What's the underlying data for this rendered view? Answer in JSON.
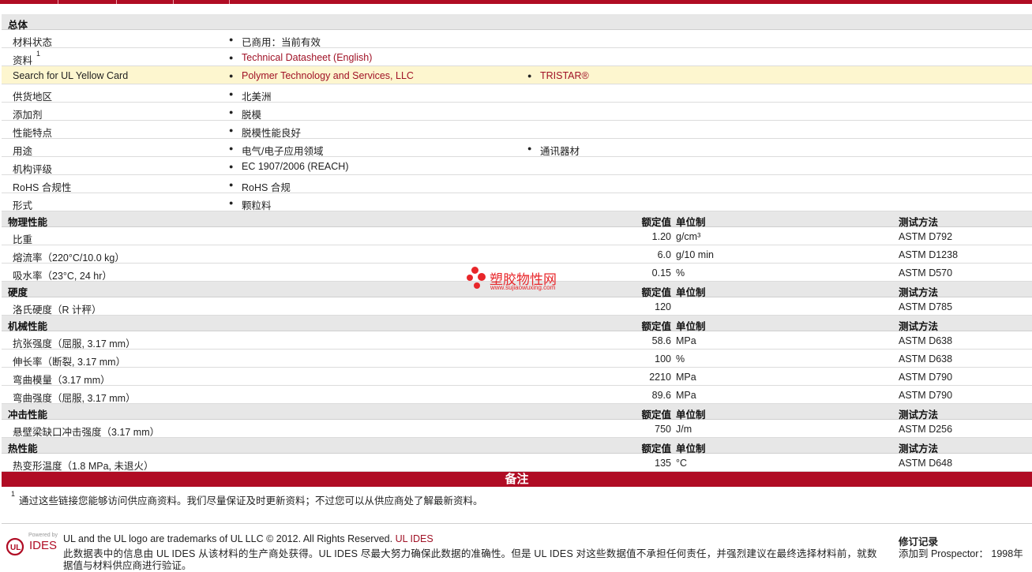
{
  "general": {
    "header": "总体",
    "rows": [
      {
        "label": "材料状态",
        "values": [
          "已商用：当前有效"
        ],
        "links": false
      },
      {
        "label": "资料",
        "sup": "1",
        "values": [
          "Technical Datasheet (English)"
        ],
        "links": true
      },
      {
        "label": "Search for UL Yellow Card",
        "values": [
          "Polymer Technology and Services, LLC",
          "TRISTAR®"
        ],
        "links": true,
        "highlight": true
      },
      {
        "label": "供货地区",
        "values": [
          "北美洲"
        ],
        "links": false
      },
      {
        "label": "添加剂",
        "values": [
          "脱模"
        ],
        "links": false
      },
      {
        "label": "性能特点",
        "values": [
          "脱模性能良好"
        ],
        "links": false
      },
      {
        "label": "用途",
        "values": [
          "电气/电子应用领域",
          "通讯器材"
        ],
        "links": false
      },
      {
        "label": "机构评级",
        "values": [
          "EC 1907/2006 (REACH)"
        ],
        "links": false
      },
      {
        "label": "RoHS 合规性",
        "values": [
          "RoHS 合规"
        ],
        "links": false
      },
      {
        "label": "形式",
        "values": [
          "颗粒料"
        ],
        "links": false
      }
    ]
  },
  "columns": {
    "rated_value": "额定值",
    "unit_system": "单位制",
    "test_method": "测试方法"
  },
  "bullet": "●",
  "sections": [
    {
      "title": "物理性能",
      "rows": [
        {
          "label": "比重",
          "value": "1.20",
          "unit": "g/cm³",
          "test": "ASTM D792"
        },
        {
          "label": "熔流率（220°C/10.0 kg）",
          "value": "6.0",
          "unit": "g/10 min",
          "test": "ASTM D1238"
        },
        {
          "label": "吸水率（23°C, 24 hr）",
          "value": "0.15",
          "unit": "%",
          "test": "ASTM D570"
        }
      ]
    },
    {
      "title": "硬度",
      "rows": [
        {
          "label": "洛氏硬度（R 计秤）",
          "value": "120",
          "unit": "",
          "test": "ASTM D785"
        }
      ]
    },
    {
      "title": "机械性能",
      "rows": [
        {
          "label": "抗张强度（屈服, 3.17 mm）",
          "value": "58.6",
          "unit": "MPa",
          "test": "ASTM D638"
        },
        {
          "label": "伸长率（断裂, 3.17 mm）",
          "value": "100",
          "unit": "%",
          "test": "ASTM D638"
        },
        {
          "label": "弯曲模量（3.17 mm）",
          "value": "2210",
          "unit": "MPa",
          "test": "ASTM D790"
        },
        {
          "label": "弯曲强度（屈服, 3.17 mm）",
          "value": "89.6",
          "unit": "MPa",
          "test": "ASTM D790"
        }
      ]
    },
    {
      "title": "冲击性能",
      "rows": [
        {
          "label": "悬壁梁缺口冲击强度（3.17 mm）",
          "value": "750",
          "unit": "J/m",
          "test": "ASTM D256"
        }
      ]
    },
    {
      "title": "热性能",
      "rows": [
        {
          "label": "热变形温度（1.8 MPa, 未退火）",
          "value": "135",
          "unit": "°C",
          "test": "ASTM D648"
        }
      ]
    }
  ],
  "notes": {
    "title": "备注",
    "sup": "1",
    "text": "通过这些链接您能够访问供应商资料。我们尽量保证及时更新资料；不过您可以从供应商处了解最新资料。"
  },
  "footer": {
    "trademark": "UL and the UL logo are trademarks of UL LLC © 2012. All Rights Reserved.",
    "trademark_link": "UL IDES",
    "disclaimer": "此数据表中的信息由  UL IDES 从该材料的生产商处获得。UL IDES 尽最大努力确保此数据的准确性。但是  UL IDES 对这些数据值不承担任何责任，并强烈建议在最终选择材料前，就数",
    "disclaimer_cont": "据值与材料供应商进行验证。",
    "logo_powered": "Powered by",
    "logo_text": "IDES",
    "revision_title": "修订记录",
    "revision_line": "添加到  Prospector：  1998年"
  },
  "watermark": {
    "text": "塑胶物性网",
    "url": "www.sujiaowuxing.com"
  },
  "colors": {
    "brand_red": "#b00c24",
    "link": "#a01226",
    "highlight": "#fdf6cf",
    "section_bg": "#e7e7e7"
  }
}
